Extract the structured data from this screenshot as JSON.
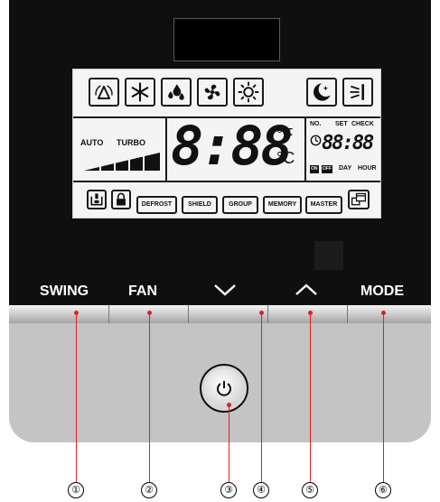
{
  "lcd": {
    "mode_icons": [
      "auto-mode-icon",
      "cool-icon",
      "dry-icon",
      "fan-icon",
      "heat-icon",
      "sleep-icon",
      "swing-icon"
    ],
    "auto_label": "AUTO",
    "turbo_label": "TURBO",
    "temperature_digits": "8:88",
    "unit_f": "°F",
    "unit_c": "°C",
    "no_label": "NO.",
    "set_label": "SET",
    "check_label": "CHECK",
    "timer_digits": "88:88",
    "on_label": "ON",
    "off_label": "OFF",
    "day_label": "DAY",
    "hour_label": "HOUR",
    "status_buttons": [
      "DEFROST",
      "SHIELD",
      "GROUP",
      "MEMORY",
      "MASTER"
    ]
  },
  "buttons": {
    "swing": "SWING",
    "fan": "FAN",
    "mode": "MODE"
  },
  "callouts": [
    "①",
    "②",
    "③",
    "④",
    "⑤",
    "⑥"
  ]
}
